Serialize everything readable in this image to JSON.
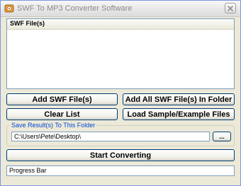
{
  "window": {
    "title": "SWF To MP3 Converter Software"
  },
  "file_list": {
    "column_header": "SWF File(s)",
    "items": []
  },
  "buttons": {
    "add_files": "Add SWF File(s)",
    "add_folder": "Add All SWF File(s) In Folder",
    "clear_list": "Clear List",
    "load_sample": "Load Sample/Example Files",
    "browse": "...",
    "start": "Start Converting"
  },
  "output_folder": {
    "label": "Save Result(s) To This Folder",
    "path": "C:\\Users\\Pete\\Desktop\\"
  },
  "progress": {
    "label": "Progress Bar"
  },
  "icons": {
    "app": "app-icon",
    "close": "close-icon"
  }
}
